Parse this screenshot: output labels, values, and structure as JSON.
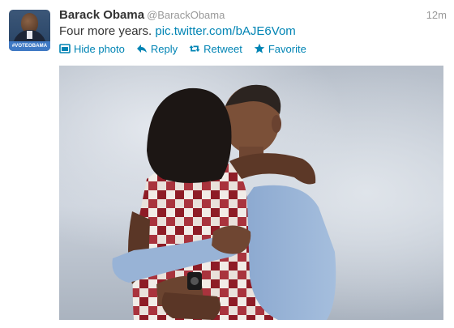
{
  "tweet": {
    "avatar_badge": "#VOTEOBAMA",
    "name": "Barack Obama",
    "handle": "@BarackObama",
    "time": "12m",
    "text": "Four more years.",
    "link": "pic.twitter.com/bAJE6Vom"
  },
  "actions": {
    "hide_photo": "Hide photo",
    "reply": "Reply",
    "retweet": "Retweet",
    "favorite": "Favorite"
  },
  "colors": {
    "link": "#0084b4",
    "meta": "#999999",
    "text": "#333333"
  }
}
